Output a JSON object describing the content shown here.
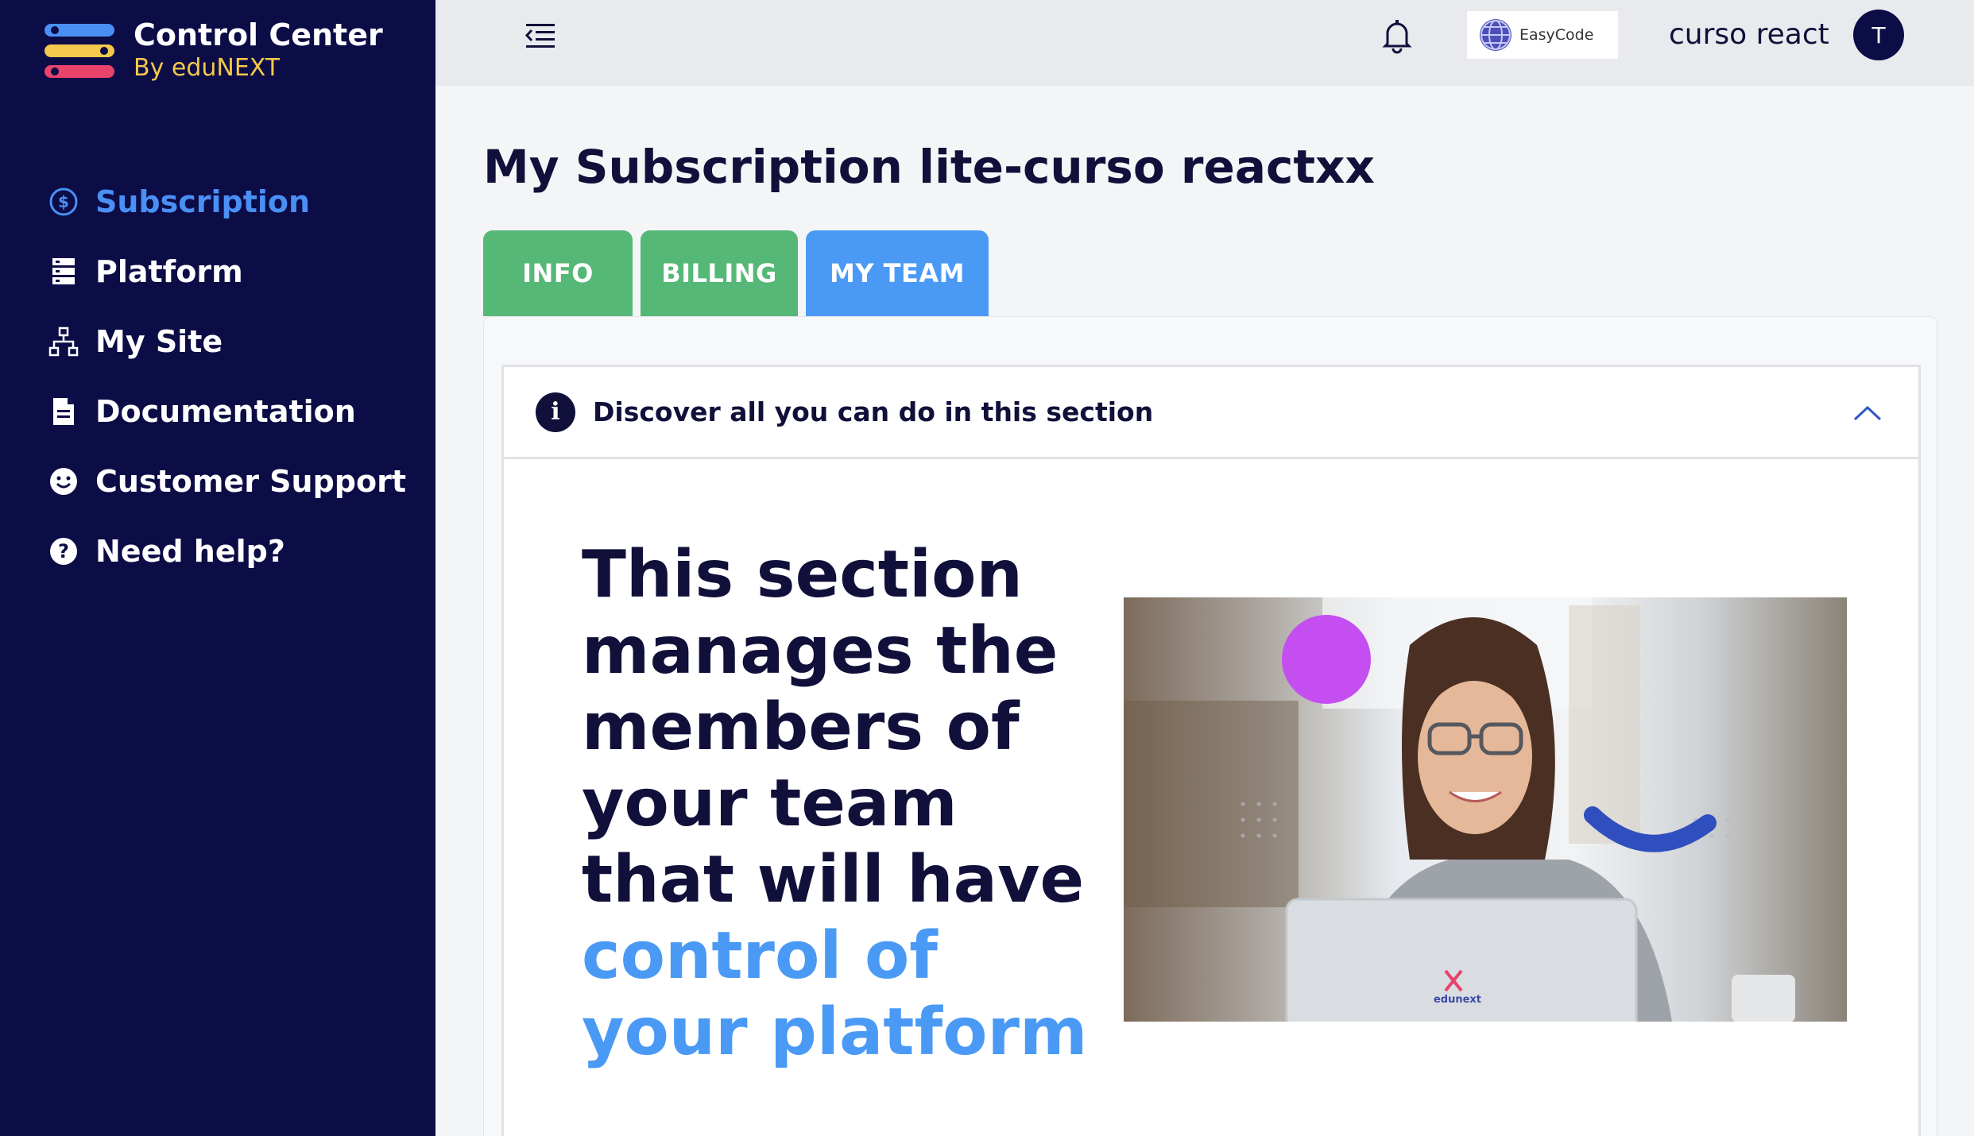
{
  "brand": {
    "title": "Control Center",
    "subtitle": "By eduNEXT",
    "colors": {
      "blue": "#4a8ff4",
      "yellow": "#f2c94c",
      "pink": "#e8436b"
    }
  },
  "sidebar": {
    "items": [
      {
        "label": "Subscription",
        "icon": "dollar-circle-icon",
        "active": true
      },
      {
        "label": "Platform",
        "icon": "server-icon",
        "active": false
      },
      {
        "label": "My Site",
        "icon": "sitemap-icon",
        "active": false
      },
      {
        "label": "Documentation",
        "icon": "document-icon",
        "active": false
      },
      {
        "label": "Customer Support",
        "icon": "smiley-icon",
        "active": false
      },
      {
        "label": "Need help?",
        "icon": "question-circle-icon",
        "active": false
      }
    ]
  },
  "topbar": {
    "menu_icon": "collapse-menu-icon",
    "notifications_icon": "bell-icon",
    "org_logo_text": "EasyCode",
    "user_name": "curso react",
    "avatar_initial": "T"
  },
  "main": {
    "title": "My Subscription lite-curso reactxx",
    "tabs": [
      {
        "label": "INFO",
        "active": false
      },
      {
        "label": "BILLING",
        "active": false
      },
      {
        "label": "MY TEAM",
        "active": true
      }
    ],
    "info_card": {
      "header": "Discover all you can do in this section",
      "hero_text": "This section manages the members of your team that will have",
      "hero_highlight": "control of your platform",
      "photo_logo_text": "edunext"
    }
  },
  "colors": {
    "sidebar_bg": "#0c0c46",
    "accent_blue": "#4a9af5",
    "tab_green": "#55b876",
    "text_dark": "#10103a"
  }
}
